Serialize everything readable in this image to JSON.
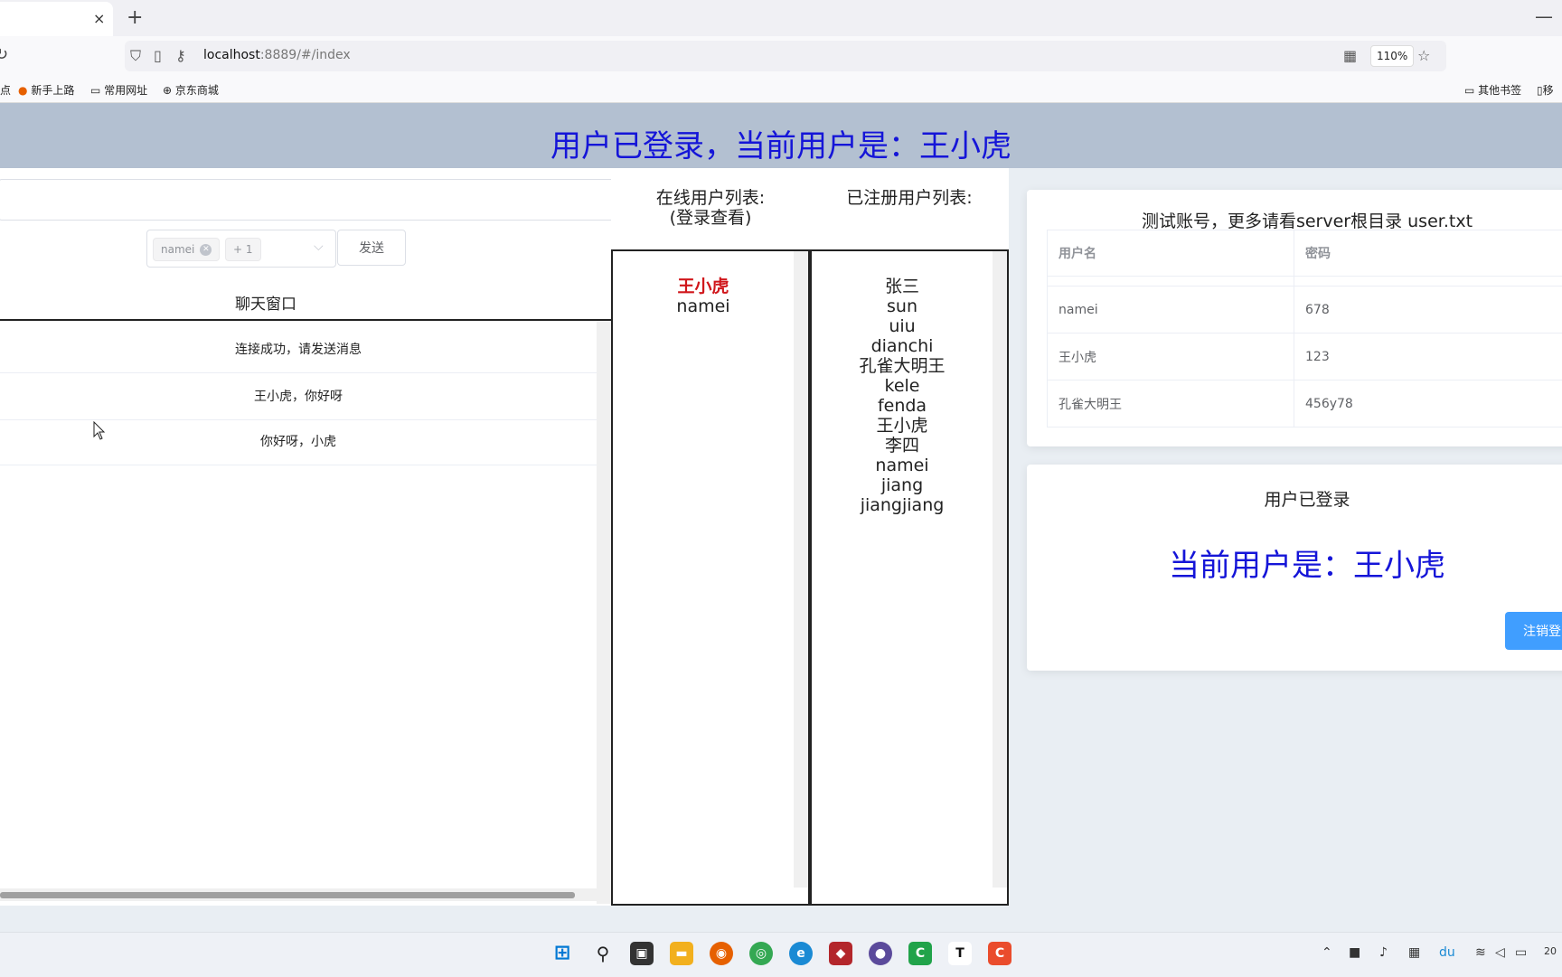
{
  "browser": {
    "tab_close": "×",
    "new_tab": "+",
    "minimize": "—",
    "url_host": "localhost",
    "url_rest": ":8889/#/index",
    "zoom": "110%",
    "bookmarks": [
      "点",
      "新手上路",
      "常用网址",
      "京东商城"
    ],
    "bookmarks_right": [
      "其他书签",
      "移"
    ]
  },
  "header": {
    "title": "用户已登录，当前用户是：王小虎"
  },
  "chat": {
    "input_value": "",
    "selected_tags": [
      "namei",
      "+ 1"
    ],
    "send_label": "发送",
    "window_title": "聊天窗口",
    "messages": [
      "连接成功，请发送消息",
      "王小虎，你好呀",
      "你好呀，小虎"
    ]
  },
  "online": {
    "title_line1": "在线用户列表:",
    "title_line2": "(登录查看)",
    "users": [
      "王小虎",
      "namei"
    ]
  },
  "registered": {
    "title": "已注册用户列表:",
    "users": [
      "张三",
      "sun",
      "uiu",
      "dianchi",
      "孔雀大明王",
      "kele",
      "fenda",
      "王小虎",
      "李四",
      "namei",
      "jiang",
      "jiangjiang"
    ]
  },
  "accounts": {
    "title": "测试账号，更多请看server根目录 user.txt",
    "headers": [
      "用户名",
      "密码"
    ],
    "rows": [
      [
        "namei",
        "678"
      ],
      [
        "王小虎",
        "123"
      ],
      [
        "孔雀大明王",
        "456y78"
      ]
    ]
  },
  "status": {
    "logged_text": "用户已登录",
    "current_user": "当前用户是：王小虎",
    "logout_label": "注销登"
  },
  "taskbar": {
    "clock": "20"
  }
}
